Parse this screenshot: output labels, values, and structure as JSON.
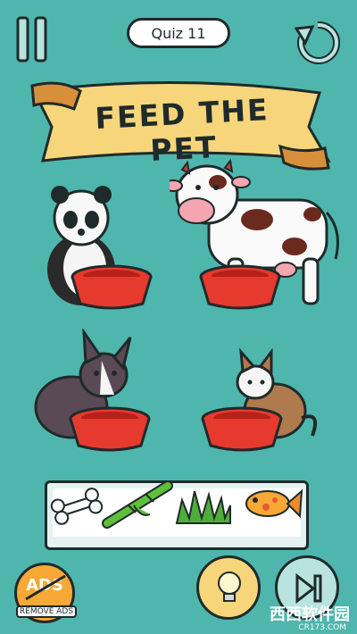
{
  "header": {
    "quiz_label": "Quiz 11"
  },
  "banner": {
    "title": "FEED THE PET"
  },
  "pets": [
    {
      "name": "panda"
    },
    {
      "name": "cow"
    },
    {
      "name": "dog"
    },
    {
      "name": "cat"
    }
  ],
  "foods": [
    "bone-icon",
    "bamboo-icon",
    "grass-icon",
    "fish-icon"
  ],
  "bottom": {
    "ads_label": "ADS",
    "remove_ads_label": "REMOVE ADS"
  },
  "watermark": {
    "text": "西西软件园",
    "sub": "CR173.COM"
  }
}
